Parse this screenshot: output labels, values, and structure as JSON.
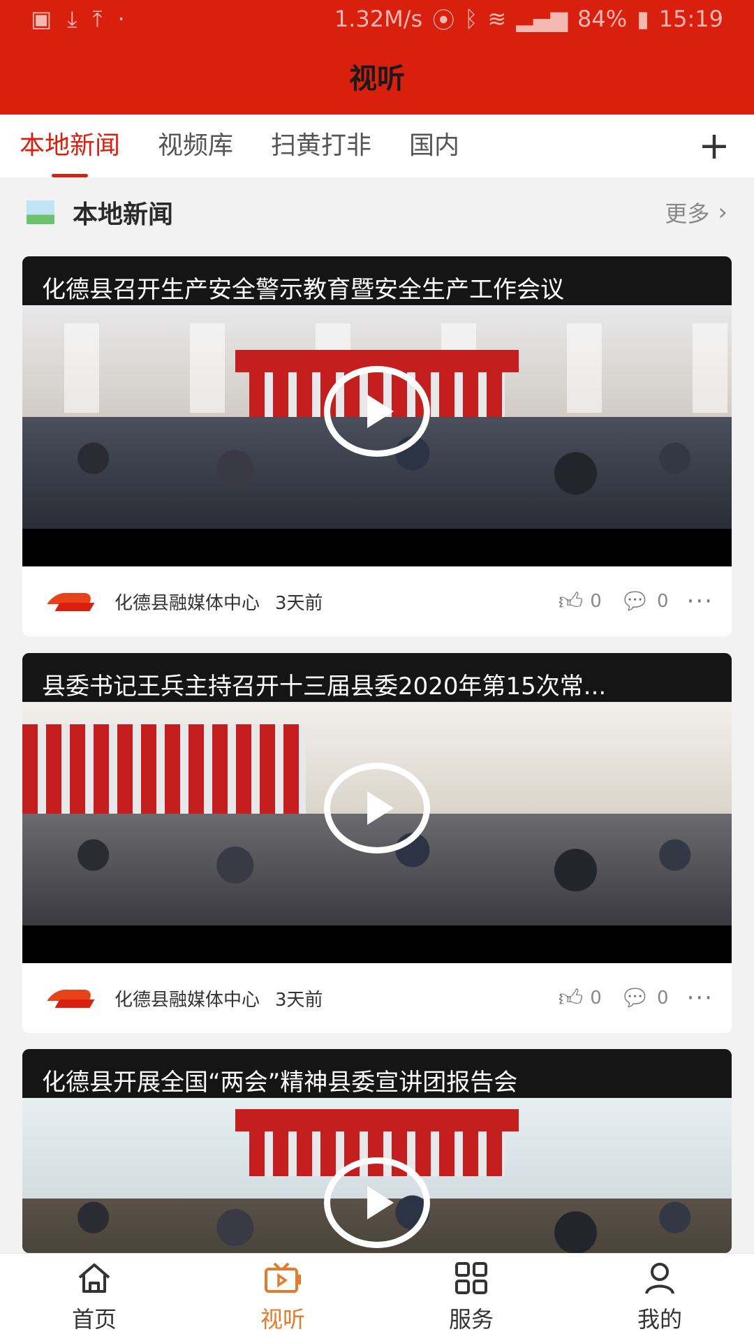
{
  "status_bar": {
    "network_speed": "1.32M/s",
    "battery": "84%",
    "time": "15:19"
  },
  "header": {
    "title": "视听"
  },
  "tabs": [
    {
      "label": "本地新闻",
      "active": true
    },
    {
      "label": "视频库",
      "active": false
    },
    {
      "label": "扫黄打非",
      "active": false
    },
    {
      "label": "国内",
      "active": false
    }
  ],
  "add_tab_icon": "plus-icon",
  "section": {
    "title": "本地新闻",
    "more_label": "更多"
  },
  "cards": [
    {
      "title": "化德县召开生产安全警示教育暨安全生产工作会议",
      "source": "化德县融媒体中心",
      "time": "3天前",
      "likes": "0",
      "comments": "0"
    },
    {
      "title": "县委书记王兵主持召开十三届县委2020年第15次常...",
      "source": "化德县融媒体中心",
      "time": "3天前",
      "likes": "0",
      "comments": "0"
    },
    {
      "title": "化德县开展全国“两会”精神县委宣讲团报告会"
    }
  ],
  "bottom_nav": [
    {
      "label": "首页",
      "icon": "home-icon",
      "active": false
    },
    {
      "label": "视听",
      "icon": "tv-icon",
      "active": true
    },
    {
      "label": "服务",
      "icon": "grid-icon",
      "active": false
    },
    {
      "label": "我的",
      "icon": "user-icon",
      "active": false
    }
  ],
  "colors": {
    "brand": "#d9200e",
    "active_nav": "#e37b2a"
  }
}
